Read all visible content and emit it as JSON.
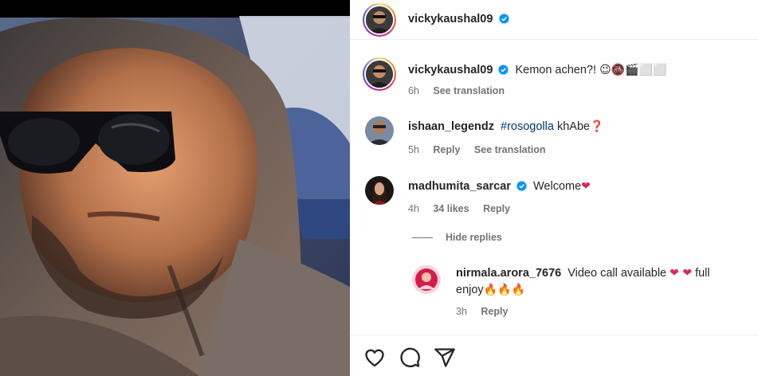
{
  "post": {
    "author": "vickykaushal09",
    "caption_username": "vickykaushal09",
    "caption_text": "Kemon achen?! ",
    "caption_emojis": "😉🚳🎬⬜⬜",
    "caption_time": "6h",
    "caption_see_translation": "See translation"
  },
  "comments": [
    {
      "username": "ishaan_legendz",
      "hashtag": "#rosogolla",
      "text": " khAbe",
      "emoji": "❓",
      "time": "5h",
      "reply": "Reply",
      "see_translation": "See translation"
    },
    {
      "username": "madhumita_sarcar",
      "text": "Welcome",
      "emoji": "❤",
      "time": "4h",
      "likes": "34 likes",
      "reply": "Reply"
    }
  ],
  "hide_replies": "Hide replies",
  "reply_comment": {
    "username": "nirmala.arora_7676",
    "text": "Video call available ",
    "emoji_hearts": "❤ ❤",
    "text2": " full",
    "line2": "enjoy",
    "fire": "🔥🔥🔥",
    "time": "3h",
    "reply": "Reply"
  },
  "colors": {
    "verified": "#0095f6",
    "heart": "#e0245e",
    "muted": "#737373"
  },
  "icons": [
    "heart-icon",
    "comment-icon",
    "share-icon",
    "verified-icon",
    "fire-icon"
  ]
}
